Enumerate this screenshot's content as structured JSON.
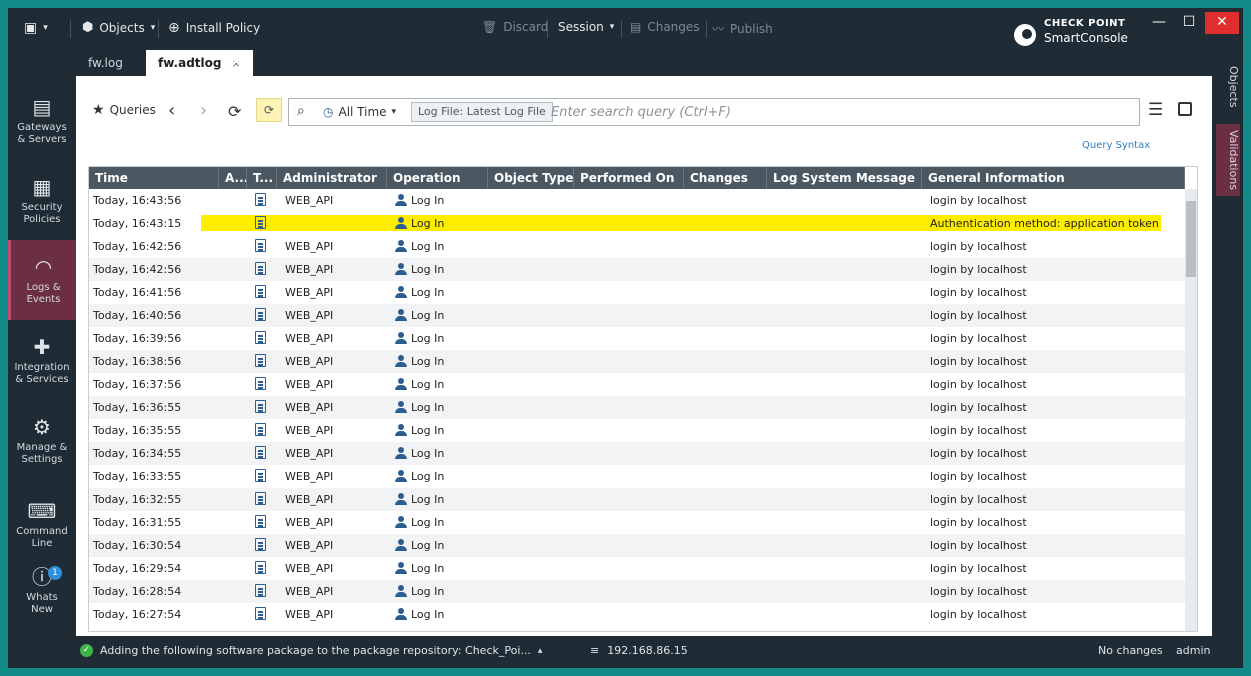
{
  "titlebar": {
    "objects_label": "Objects",
    "install_policy_label": "Install Policy",
    "discard_label": "Discard",
    "session_label": "Session",
    "changes_label": "Changes",
    "publish_label": "Publish",
    "brand_line1": "CHECK POINT",
    "brand_line2": "SmartConsole"
  },
  "tabs": [
    {
      "label": "fw.log"
    },
    {
      "label": "fw.adtlog",
      "close": "×"
    }
  ],
  "leftnav": [
    {
      "label1": "Gateways",
      "label2": "& Servers",
      "icon": "gateways-icon"
    },
    {
      "label1": "Security",
      "label2": "Policies",
      "icon": "security-policies-icon"
    },
    {
      "label1": "Logs &",
      "label2": "Events",
      "icon": "logs-gauge-icon"
    },
    {
      "label1": "Integration",
      "label2": "& Services",
      "icon": "puzzle-icon"
    },
    {
      "label1": "Manage &",
      "label2": "Settings",
      "icon": "gear-icon"
    },
    {
      "label1": "Command",
      "label2": "Line",
      "icon": "terminal-icon"
    },
    {
      "label1": "Whats",
      "label2": "New",
      "icon": "help-icon",
      "badge": "1"
    }
  ],
  "rightnav": [
    {
      "label": "Objects"
    },
    {
      "label": "Validations"
    }
  ],
  "toolbar": {
    "queries_label": "Queries",
    "time_label": "All Time",
    "chip_label": "Log File: Latest Log File",
    "search_placeholder": "Enter search query (Ctrl+F)",
    "query_syntax_label": "Query Syntax"
  },
  "table": {
    "columns": [
      "Time",
      "A...",
      "T...",
      "Administrator",
      "Operation",
      "Object Type",
      "Performed On",
      "Changes",
      "Log System Message",
      "General Information"
    ],
    "rows": [
      {
        "time": "Today, 16:43:56",
        "admin": "WEB_API",
        "op": "Log In",
        "info": "login by localhost"
      },
      {
        "time": "Today, 16:43:15",
        "admin": "",
        "op": "Log In",
        "info": "Authentication method: application token"
      },
      {
        "time": "Today, 16:42:56",
        "admin": "WEB_API",
        "op": "Log In",
        "info": "login by localhost"
      },
      {
        "time": "Today, 16:42:56",
        "admin": "WEB_API",
        "op": "Log In",
        "info": "login by localhost"
      },
      {
        "time": "Today, 16:41:56",
        "admin": "WEB_API",
        "op": "Log In",
        "info": "login by localhost"
      },
      {
        "time": "Today, 16:40:56",
        "admin": "WEB_API",
        "op": "Log In",
        "info": "login by localhost"
      },
      {
        "time": "Today, 16:39:56",
        "admin": "WEB_API",
        "op": "Log In",
        "info": "login by localhost"
      },
      {
        "time": "Today, 16:38:56",
        "admin": "WEB_API",
        "op": "Log In",
        "info": "login by localhost"
      },
      {
        "time": "Today, 16:37:56",
        "admin": "WEB_API",
        "op": "Log In",
        "info": "login by localhost"
      },
      {
        "time": "Today, 16:36:55",
        "admin": "WEB_API",
        "op": "Log In",
        "info": "login by localhost"
      },
      {
        "time": "Today, 16:35:55",
        "admin": "WEB_API",
        "op": "Log In",
        "info": "login by localhost"
      },
      {
        "time": "Today, 16:34:55",
        "admin": "WEB_API",
        "op": "Log In",
        "info": "login by localhost"
      },
      {
        "time": "Today, 16:33:55",
        "admin": "WEB_API",
        "op": "Log In",
        "info": "login by localhost"
      },
      {
        "time": "Today, 16:32:55",
        "admin": "WEB_API",
        "op": "Log In",
        "info": "login by localhost"
      },
      {
        "time": "Today, 16:31:55",
        "admin": "WEB_API",
        "op": "Log In",
        "info": "login by localhost"
      },
      {
        "time": "Today, 16:30:54",
        "admin": "WEB_API",
        "op": "Log In",
        "info": "login by localhost"
      },
      {
        "time": "Today, 16:29:54",
        "admin": "WEB_API",
        "op": "Log In",
        "info": "login by localhost"
      },
      {
        "time": "Today, 16:28:54",
        "admin": "WEB_API",
        "op": "Log In",
        "info": "login by localhost"
      },
      {
        "time": "Today, 16:27:54",
        "admin": "WEB_API",
        "op": "Log In",
        "info": "login by localhost"
      }
    ],
    "highlight_row_index": 1,
    "highlight_color": "#ffed00"
  },
  "statusbar": {
    "task_text": "Adding the following software package to the package repository: Check_Poi...",
    "server_ip": "192.168.86.15",
    "changes_text": "No changes",
    "user": "admin"
  },
  "colors": {
    "accent": "#6b2e43",
    "header": "#4b5862",
    "frame": "#1f2c35",
    "desktop": "#128a87"
  }
}
